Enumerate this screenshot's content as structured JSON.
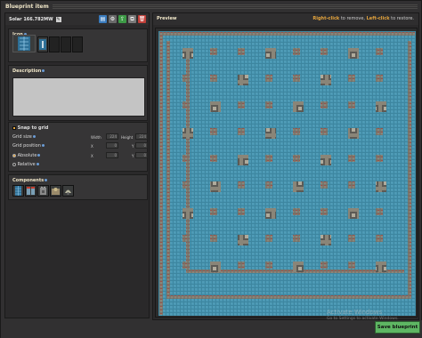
{
  "window": {
    "title": "Blueprint item"
  },
  "blueprint": {
    "name": "Solar 166.782MW"
  },
  "toolbar": {
    "buttons": [
      "blueprint-book-icon",
      "settings-icon",
      "export-icon",
      "copy-icon",
      "delete-icon"
    ]
  },
  "icon_section": {
    "label": "Icon"
  },
  "description": {
    "label": "Description",
    "value": ""
  },
  "grid": {
    "snap_label": "Snap to grid",
    "size_label": "Grid size",
    "width_label": "Width",
    "width_value": "224",
    "height_label": "Height",
    "height_value": "224",
    "position_label": "Grid position",
    "x_label": "X",
    "y_label": "Y",
    "pos_x": "0",
    "pos_y": "0",
    "abs_x": "0",
    "abs_y": "0",
    "absolute_label": "Absolute",
    "relative_label": "Relative"
  },
  "components": {
    "label": "Components",
    "items": [
      "solar-panel-icon",
      "accumulator-icon",
      "substation-icon",
      "roboport-icon",
      "radar-icon"
    ]
  },
  "preview": {
    "label": "Preview",
    "hint_key1": "Right-click",
    "hint_text1": " to remove, ",
    "hint_key2": "Left-click",
    "hint_text2": " to restore."
  },
  "footer": {
    "save_label": "Save blueprint"
  },
  "watermark": {
    "line1": "Activate Windows",
    "line2": "Go to Settings to activate Windows."
  },
  "colors": {
    "accent": "#e7a63d",
    "save": "#5eb663",
    "solar": "#3a8aa8"
  }
}
